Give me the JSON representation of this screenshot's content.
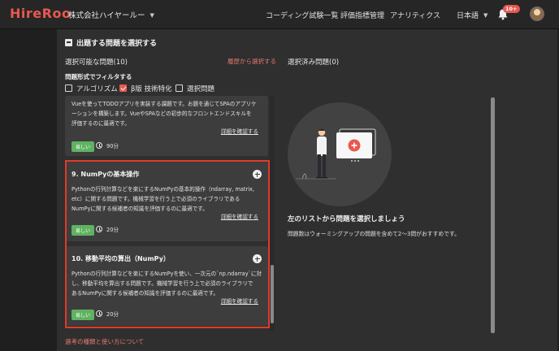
{
  "header": {
    "logo_prefix": "HireR",
    "logo_suffix": "o",
    "company": "株式会社ハイヤールー",
    "nav": [
      "コーディング試験一覧",
      "評価指標管理",
      "アナリティクス"
    ],
    "language": "日本語",
    "notification_count": "10+",
    "colors": {
      "brand": "#e8584f"
    }
  },
  "section": {
    "title": "出題する問題を選択する",
    "available_label": "選択可能な問題(10)",
    "history_link": "履歴から選択する",
    "selected_label": "選択済み問題(0)",
    "filter_heading": "問題形式でフィルタする",
    "filters": [
      {
        "label": "アルゴリズム",
        "checked": false
      },
      {
        "label": "β版 技術特化",
        "checked": true
      },
      {
        "label": "選択問題",
        "checked": false
      }
    ]
  },
  "cards": [
    {
      "title": "",
      "description_lines": [
        "Vueを使ってTODOアプリを実装する課題です。お題を通じてSPAのアプリケ",
        "ーションを構築します。VueやSPAなどの初歩的なフロントエンドスキルを",
        "評価するのに最適です。"
      ],
      "detail_link": "詳細を確認する",
      "difficulty": "易しい",
      "time": "90分"
    },
    {
      "title": "9. NumPyの基本操作",
      "description_lines": [
        "Pythonの行列計算などを楽にするNumPyの基本的操作（ndarray, matrix,",
        "etc）に関する問題です。機械学習を行う上で必須のライブラリである",
        "NumPyに関する候補者の知識を評価するのに最適です。"
      ],
      "detail_link": "詳細を確認する",
      "difficulty": "易しい",
      "time": "20分"
    },
    {
      "title": "10. 移動平均の算出（NumPy）",
      "description_lines": [
        "Pythonの行列計算などを楽にするNumPyを使い、一次元の`np.ndarray`に対",
        "し、移動平均を算出する問題です。機械学習を行う上で必須のライブラリで",
        "あるNumPyに関する候補者の知識を評価するのに最適です。"
      ],
      "detail_link": "詳細を確認する",
      "difficulty": "易しい",
      "time": "20分"
    }
  ],
  "empty_state": {
    "title": "左のリストから問題を選択しましょう",
    "subtitle": "問題数はウォーミングアップの問題を含めて2〜3問がおすすめです。"
  },
  "footer_link": "選考の種類と使い方について"
}
